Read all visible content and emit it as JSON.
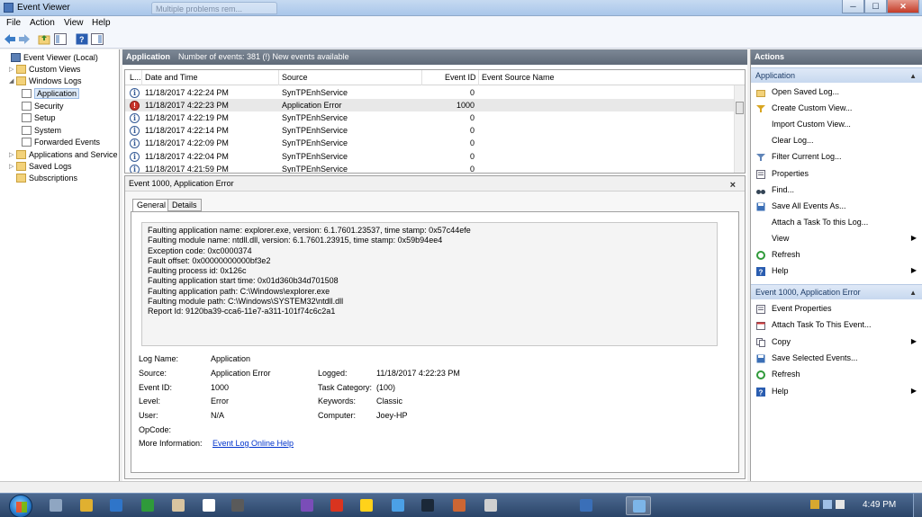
{
  "window": {
    "title": "Event Viewer",
    "ghost_tab": "Multiple problems rem...",
    "controls": {
      "minimize": "─",
      "maximize": "☐",
      "close": "✕"
    }
  },
  "menu": [
    "File",
    "Action",
    "View",
    "Help"
  ],
  "tree": {
    "root": "Event Viewer (Local)",
    "custom_views": "Custom Views",
    "windows_logs": "Windows Logs",
    "application": "Application",
    "security": "Security",
    "setup": "Setup",
    "system": "System",
    "forwarded": "Forwarded Events",
    "apps_services": "Applications and Service",
    "saved_logs": "Saved Logs",
    "subscriptions": "Subscriptions"
  },
  "header": {
    "log_name": "Application",
    "summary": "Number of events: 381 (!) New events available"
  },
  "grid": {
    "columns": {
      "level": "L...",
      "date": "Date and Time",
      "source": "Source",
      "event_id": "Event ID",
      "event_source_name": "Event Source Name"
    },
    "rows": [
      {
        "level": "info",
        "date": "11/18/2017 4:22:24 PM",
        "source": "SynTPEnhService",
        "event_id": "0"
      },
      {
        "level": "error",
        "date": "11/18/2017 4:22:23 PM",
        "source": "Application Error",
        "event_id": "1000"
      },
      {
        "level": "info",
        "date": "11/18/2017 4:22:19 PM",
        "source": "SynTPEnhService",
        "event_id": "0"
      },
      {
        "level": "info",
        "date": "11/18/2017 4:22:14 PM",
        "source": "SynTPEnhService",
        "event_id": "0"
      },
      {
        "level": "info",
        "date": "11/18/2017 4:22:09 PM",
        "source": "SynTPEnhService",
        "event_id": "0"
      },
      {
        "level": "info",
        "date": "11/18/2017 4:22:04 PM",
        "source": "SynTPEnhService",
        "event_id": "0"
      },
      {
        "level": "info",
        "date": "11/18/2017 4:21:59 PM",
        "source": "SynTPEnhService",
        "event_id": "0"
      }
    ]
  },
  "detail": {
    "title": "Event 1000, Application Error",
    "close": "×",
    "tabs": {
      "general": "General",
      "details": "Details"
    },
    "description": "Faulting application name: explorer.exe, version: 6.1.7601.23537, time stamp: 0x57c44efe\nFaulting module name: ntdll.dll, version: 6.1.7601.23915, time stamp: 0x59b94ee4\nException code: 0xc0000374\nFault offset: 0x00000000000bf3e2\nFaulting process id: 0x126c\nFaulting application start time: 0x01d360b34d701508\nFaulting application path: C:\\Windows\\explorer.exe\nFaulting module path: C:\\Windows\\SYSTEM32\\ntdll.dll\nReport Id: 9120ba39-cca6-11e7-a311-101f74c6c2a1",
    "labels": {
      "log_name": "Log Name:",
      "source": "Source:",
      "event_id": "Event ID:",
      "level": "Level:",
      "user": "User:",
      "opcode": "OpCode:",
      "more_info": "More Information:",
      "logged": "Logged:",
      "task_category": "Task Category:",
      "keywords": "Keywords:",
      "computer": "Computer:"
    },
    "values": {
      "log_name": "Application",
      "source": "Application Error",
      "event_id": "1000",
      "level": "Error",
      "user": "N/A",
      "more_info_link": "Event Log Online Help",
      "logged": "11/18/2017 4:22:23 PM",
      "task_category": "(100)",
      "keywords": "Classic",
      "computer": "Joey-HP"
    }
  },
  "actions": {
    "title": "Actions",
    "section1": "Application",
    "items1": [
      {
        "label": "Open Saved Log...",
        "icon": "folder-open-icon"
      },
      {
        "label": "Create Custom View...",
        "icon": "filter-create-icon"
      },
      {
        "label": "Import Custom View...",
        "icon": ""
      },
      {
        "label": "Clear Log...",
        "icon": ""
      },
      {
        "label": "Filter Current Log...",
        "icon": "filter-icon"
      },
      {
        "label": "Properties",
        "icon": "properties-icon"
      },
      {
        "label": "Find...",
        "icon": "binoculars-icon"
      },
      {
        "label": "Save All Events As...",
        "icon": "save-icon"
      },
      {
        "label": "Attach a Task To this Log...",
        "icon": ""
      },
      {
        "label": "View",
        "icon": "",
        "submenu": true
      },
      {
        "label": "Refresh",
        "icon": "refresh-icon"
      },
      {
        "label": "Help",
        "icon": "help-icon",
        "submenu": true
      }
    ],
    "section2": "Event 1000, Application Error",
    "items2": [
      {
        "label": "Event Properties",
        "icon": "properties-icon"
      },
      {
        "label": "Attach Task To This Event...",
        "icon": "task-icon"
      },
      {
        "label": "Copy",
        "icon": "copy-icon",
        "submenu": true
      },
      {
        "label": "Save Selected Events...",
        "icon": "save-icon"
      },
      {
        "label": "Refresh",
        "icon": "refresh-icon"
      },
      {
        "label": "Help",
        "icon": "help-icon",
        "submenu": true
      }
    ]
  },
  "taskbar": {
    "clock": "4:49 PM",
    "apps": [
      "chrome-icon",
      "blender-icon",
      "minecraft-icon",
      "steam-icon",
      "event-viewer-icon"
    ]
  }
}
